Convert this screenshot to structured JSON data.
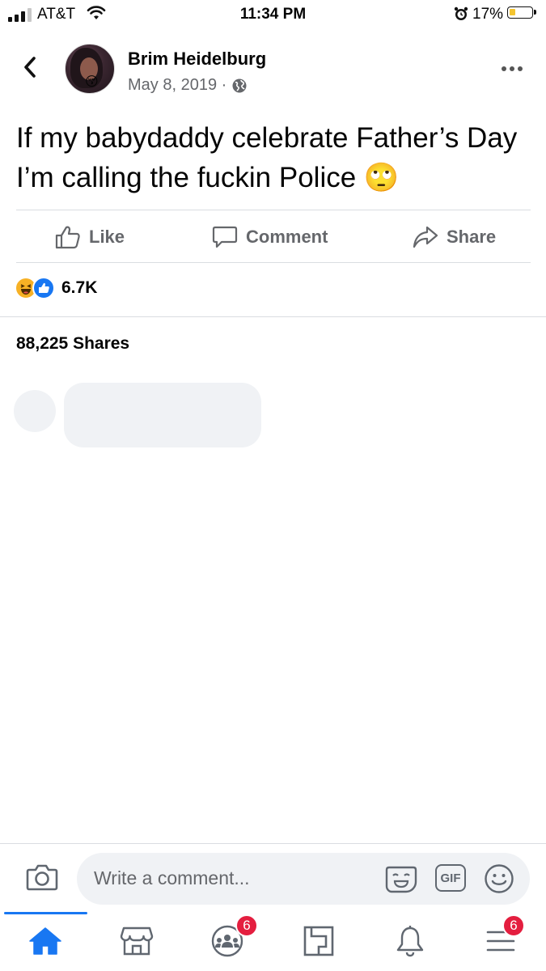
{
  "status_bar": {
    "carrier": "AT&T",
    "time": "11:34 PM",
    "battery_percent": "17%",
    "battery_level": 0.17,
    "icons": [
      "signal-icon",
      "wifi-icon",
      "alarm-icon",
      "battery-icon"
    ]
  },
  "post": {
    "author": "Brim Heidelburg",
    "date": "May 8, 2019 ·",
    "audience_icon": "globe-icon",
    "text": "If my babydaddy celebrate Father’s Day I’m calling the fuckin Police 🙄",
    "actions": {
      "like_label": "Like",
      "comment_label": "Comment",
      "share_label": "Share"
    },
    "reactions": {
      "icons": [
        "haha-reaction-icon",
        "like-reaction-icon"
      ],
      "count": "6.7K"
    },
    "shares_text": "88,225 Shares"
  },
  "composer": {
    "placeholder": "Write a comment...",
    "gif_label": "GIF"
  },
  "bottom_nav": {
    "items": [
      {
        "name": "home",
        "icon": "home-icon",
        "active": true
      },
      {
        "name": "marketplace",
        "icon": "shop-icon"
      },
      {
        "name": "groups",
        "icon": "groups-icon",
        "badge": "6"
      },
      {
        "name": "pages",
        "icon": "pages-icon"
      },
      {
        "name": "notifications",
        "icon": "bell-icon"
      },
      {
        "name": "menu",
        "icon": "menu-icon",
        "badge": "6"
      }
    ]
  },
  "colors": {
    "accent": "#1877f2",
    "badge": "#e41e3f",
    "secondary_text": "#65676b",
    "battery_fill": "#f4c430"
  }
}
